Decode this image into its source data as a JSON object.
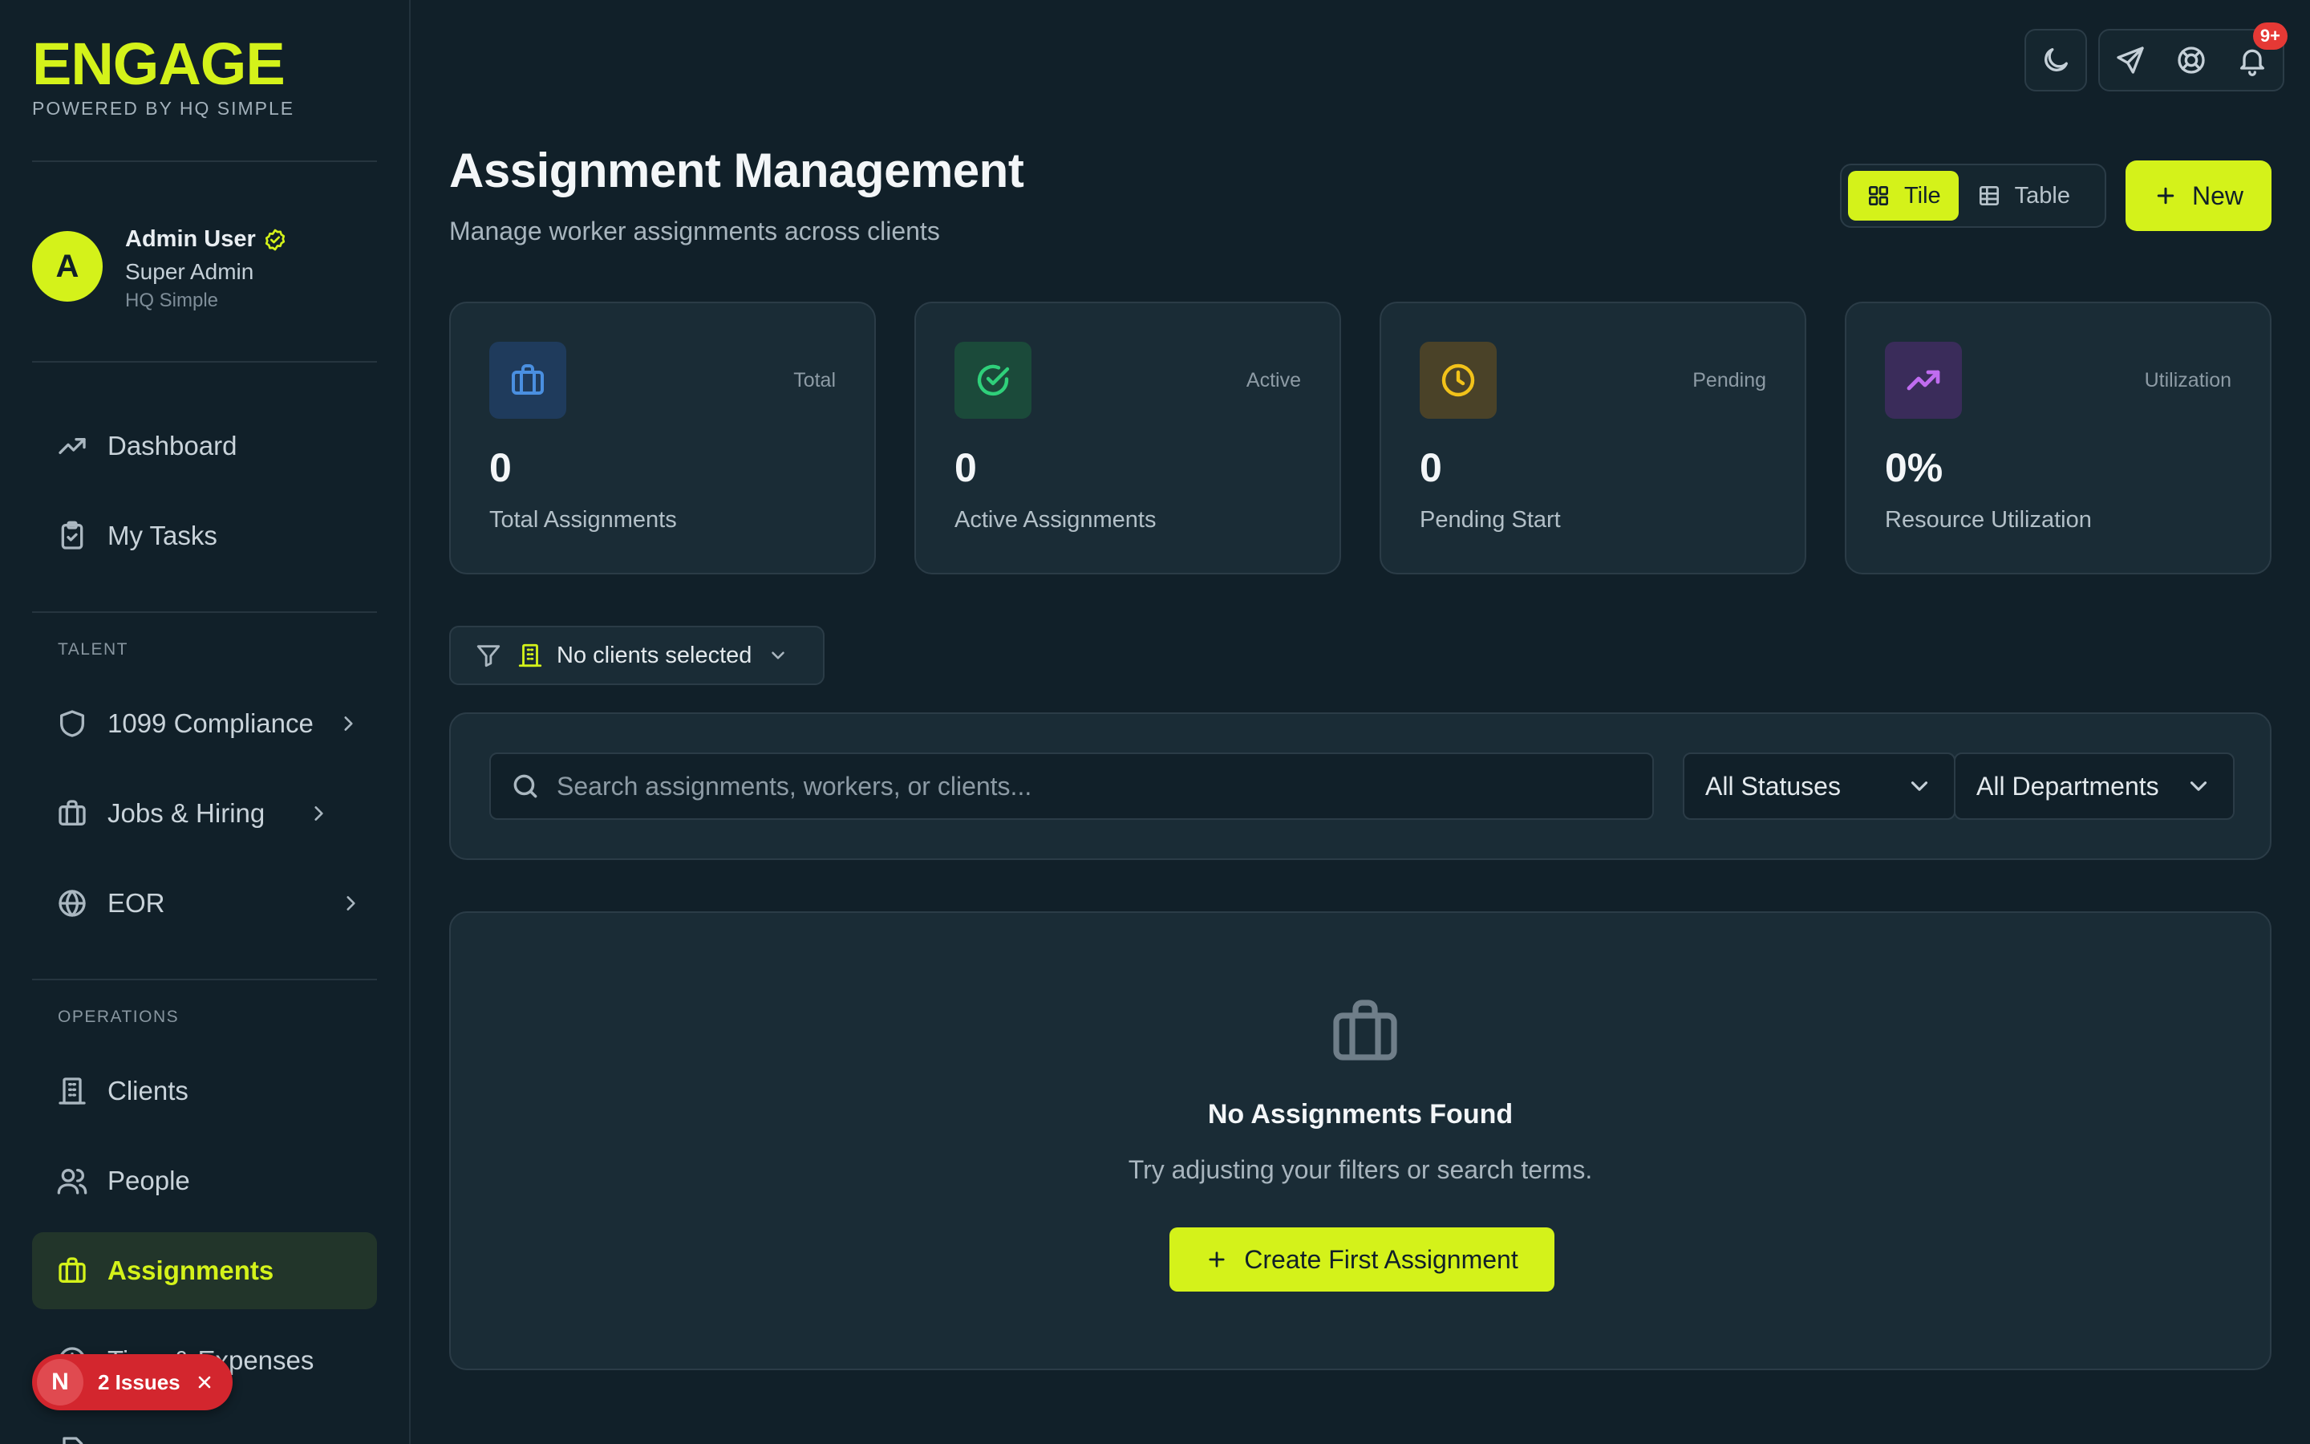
{
  "brand": {
    "logo": "ENGAGE",
    "tagline": "POWERED BY HQ SIMPLE"
  },
  "profile": {
    "initial": "A",
    "name": "Admin User",
    "role": "Super Admin",
    "org": "HQ Simple"
  },
  "nav": {
    "dashboard": "Dashboard",
    "my_tasks": "My Tasks",
    "talent_label": "TALENT",
    "compliance": "1099 Compliance",
    "jobs": "Jobs & Hiring",
    "eor": "EOR",
    "operations_label": "OPERATIONS",
    "clients": "Clients",
    "people": "People",
    "assignments": "Assignments",
    "time_expenses": "Time & Expenses"
  },
  "issues": {
    "letter": "N",
    "label": "2 Issues"
  },
  "topbar": {
    "notification_badge": "9+"
  },
  "header": {
    "title": "Assignment Management",
    "subtitle": "Manage worker assignments across clients"
  },
  "view_toggle": {
    "tile": "Tile",
    "table": "Table",
    "active": "Tile"
  },
  "new_button": "New",
  "stats": [
    {
      "tag": "Total",
      "value": "0",
      "label": "Total Assignments",
      "icon": "briefcase-icon",
      "color": "#4a8fe0",
      "bg": "#1f3b5c"
    },
    {
      "tag": "Active",
      "value": "0",
      "label": "Active Assignments",
      "icon": "check-circle-icon",
      "color": "#2fd07a",
      "bg": "#1b4a3a"
    },
    {
      "tag": "Pending",
      "value": "0",
      "label": "Pending Start",
      "icon": "clock-icon",
      "color": "#f2c21a",
      "bg": "#4a4228"
    },
    {
      "tag": "Utilization",
      "value": "0%",
      "label": "Resource Utilization",
      "icon": "trending-up-icon",
      "color": "#c06cf0",
      "bg": "#3a2c5a"
    }
  ],
  "client_filter": "No clients selected",
  "search": {
    "placeholder": "Search assignments, workers, or clients...",
    "value": ""
  },
  "status_select": "All Statuses",
  "department_select": "All Departments",
  "empty_state": {
    "title": "No Assignments Found",
    "subtitle": "Try adjusting your filters or search terms.",
    "button": "Create First Assignment"
  },
  "colors": {
    "accent": "#d4f21a",
    "background": "#112029",
    "panel": "#1a2c36",
    "danger": "#d3262e"
  }
}
